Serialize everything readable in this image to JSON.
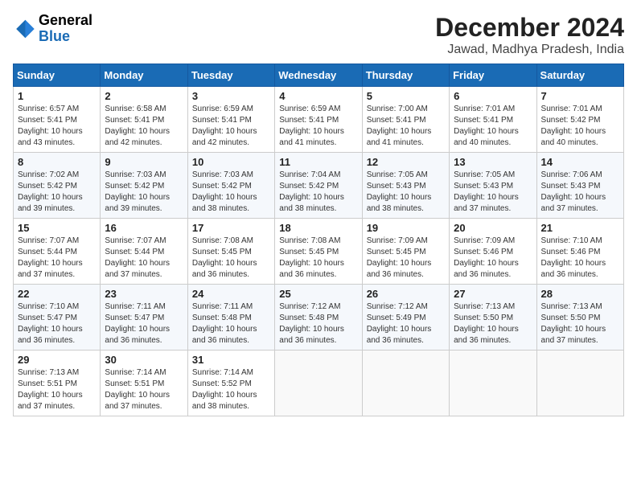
{
  "logo": {
    "line1": "General",
    "line2": "Blue"
  },
  "title": "December 2024",
  "subtitle": "Jawad, Madhya Pradesh, India",
  "days_of_week": [
    "Sunday",
    "Monday",
    "Tuesday",
    "Wednesday",
    "Thursday",
    "Friday",
    "Saturday"
  ],
  "weeks": [
    [
      {
        "day": 1,
        "sunrise": "6:57 AM",
        "sunset": "5:41 PM",
        "daylight": "10 hours and 43 minutes."
      },
      {
        "day": 2,
        "sunrise": "6:58 AM",
        "sunset": "5:41 PM",
        "daylight": "10 hours and 42 minutes."
      },
      {
        "day": 3,
        "sunrise": "6:59 AM",
        "sunset": "5:41 PM",
        "daylight": "10 hours and 42 minutes."
      },
      {
        "day": 4,
        "sunrise": "6:59 AM",
        "sunset": "5:41 PM",
        "daylight": "10 hours and 41 minutes."
      },
      {
        "day": 5,
        "sunrise": "7:00 AM",
        "sunset": "5:41 PM",
        "daylight": "10 hours and 41 minutes."
      },
      {
        "day": 6,
        "sunrise": "7:01 AM",
        "sunset": "5:41 PM",
        "daylight": "10 hours and 40 minutes."
      },
      {
        "day": 7,
        "sunrise": "7:01 AM",
        "sunset": "5:42 PM",
        "daylight": "10 hours and 40 minutes."
      }
    ],
    [
      {
        "day": 8,
        "sunrise": "7:02 AM",
        "sunset": "5:42 PM",
        "daylight": "10 hours and 39 minutes."
      },
      {
        "day": 9,
        "sunrise": "7:03 AM",
        "sunset": "5:42 PM",
        "daylight": "10 hours and 39 minutes."
      },
      {
        "day": 10,
        "sunrise": "7:03 AM",
        "sunset": "5:42 PM",
        "daylight": "10 hours and 38 minutes."
      },
      {
        "day": 11,
        "sunrise": "7:04 AM",
        "sunset": "5:42 PM",
        "daylight": "10 hours and 38 minutes."
      },
      {
        "day": 12,
        "sunrise": "7:05 AM",
        "sunset": "5:43 PM",
        "daylight": "10 hours and 38 minutes."
      },
      {
        "day": 13,
        "sunrise": "7:05 AM",
        "sunset": "5:43 PM",
        "daylight": "10 hours and 37 minutes."
      },
      {
        "day": 14,
        "sunrise": "7:06 AM",
        "sunset": "5:43 PM",
        "daylight": "10 hours and 37 minutes."
      }
    ],
    [
      {
        "day": 15,
        "sunrise": "7:07 AM",
        "sunset": "5:44 PM",
        "daylight": "10 hours and 37 minutes."
      },
      {
        "day": 16,
        "sunrise": "7:07 AM",
        "sunset": "5:44 PM",
        "daylight": "10 hours and 37 minutes."
      },
      {
        "day": 17,
        "sunrise": "7:08 AM",
        "sunset": "5:45 PM",
        "daylight": "10 hours and 36 minutes."
      },
      {
        "day": 18,
        "sunrise": "7:08 AM",
        "sunset": "5:45 PM",
        "daylight": "10 hours and 36 minutes."
      },
      {
        "day": 19,
        "sunrise": "7:09 AM",
        "sunset": "5:45 PM",
        "daylight": "10 hours and 36 minutes."
      },
      {
        "day": 20,
        "sunrise": "7:09 AM",
        "sunset": "5:46 PM",
        "daylight": "10 hours and 36 minutes."
      },
      {
        "day": 21,
        "sunrise": "7:10 AM",
        "sunset": "5:46 PM",
        "daylight": "10 hours and 36 minutes."
      }
    ],
    [
      {
        "day": 22,
        "sunrise": "7:10 AM",
        "sunset": "5:47 PM",
        "daylight": "10 hours and 36 minutes."
      },
      {
        "day": 23,
        "sunrise": "7:11 AM",
        "sunset": "5:47 PM",
        "daylight": "10 hours and 36 minutes."
      },
      {
        "day": 24,
        "sunrise": "7:11 AM",
        "sunset": "5:48 PM",
        "daylight": "10 hours and 36 minutes."
      },
      {
        "day": 25,
        "sunrise": "7:12 AM",
        "sunset": "5:48 PM",
        "daylight": "10 hours and 36 minutes."
      },
      {
        "day": 26,
        "sunrise": "7:12 AM",
        "sunset": "5:49 PM",
        "daylight": "10 hours and 36 minutes."
      },
      {
        "day": 27,
        "sunrise": "7:13 AM",
        "sunset": "5:50 PM",
        "daylight": "10 hours and 36 minutes."
      },
      {
        "day": 28,
        "sunrise": "7:13 AM",
        "sunset": "5:50 PM",
        "daylight": "10 hours and 37 minutes."
      }
    ],
    [
      {
        "day": 29,
        "sunrise": "7:13 AM",
        "sunset": "5:51 PM",
        "daylight": "10 hours and 37 minutes."
      },
      {
        "day": 30,
        "sunrise": "7:14 AM",
        "sunset": "5:51 PM",
        "daylight": "10 hours and 37 minutes."
      },
      {
        "day": 31,
        "sunrise": "7:14 AM",
        "sunset": "5:52 PM",
        "daylight": "10 hours and 38 minutes."
      },
      null,
      null,
      null,
      null
    ]
  ]
}
